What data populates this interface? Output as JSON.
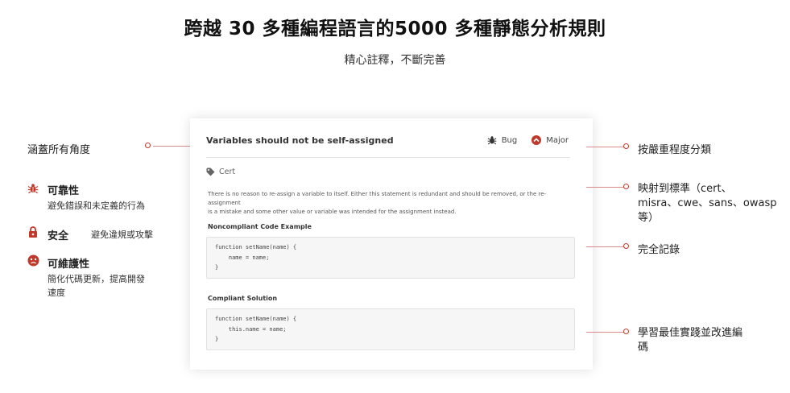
{
  "header": {
    "title": "跨越 30 多種編程語言的5000 多種靜態分析規則",
    "subtitle": "精心註釋，不斷完善"
  },
  "rule_card": {
    "title": "Variables should not be self-assigned",
    "type_label": "Bug",
    "severity_label": "Major",
    "tag": "Cert",
    "description_line1": "There is no reason to re-assign a variable to itself. Either this statement is redundant and should be removed, or the re-assignment",
    "description_line2": "is a mistake and some other value or variable was intended for the assignment instead.",
    "noncompliant_heading": "Noncompliant Code Example",
    "noncompliant_code": [
      "function setName(name) {",
      "    name = name;",
      "}"
    ],
    "compliant_heading": "Compliant Solution",
    "compliant_code": [
      "function setName(name) {",
      "    this.name = name;",
      "}"
    ]
  },
  "left_features": {
    "coverage": "涵蓋所有角度",
    "reliability": {
      "label": "可靠性",
      "desc_line1": "避免錯誤和未定義的行為"
    },
    "security": {
      "label": "安全",
      "desc": "避免違規或攻擊"
    },
    "maintainability": {
      "label": "可維護性",
      "desc_line1": "簡化代碼更新，提高開發",
      "desc_line2": "速度"
    }
  },
  "right_callouts": {
    "severity": "按嚴重程度分類",
    "standards_line1": "映射到標準（cert、",
    "standards_line2": "misra、cwe、sans、owasp",
    "standards_line3": "等）",
    "documentation": "完全記錄",
    "best_practices_line1": "學習最佳實踐並改進編",
    "best_practices_line2": "碼"
  },
  "colors": {
    "accent": "#c0392b",
    "connector": "#d98a8a",
    "code_bg": "#f6f6f6"
  },
  "icons": {
    "type": "bug-icon",
    "severity": "major-severity-icon",
    "tag": "tag-icon",
    "reliability": "bug-icon",
    "security": "lock-icon",
    "maintainability": "face-icon"
  }
}
